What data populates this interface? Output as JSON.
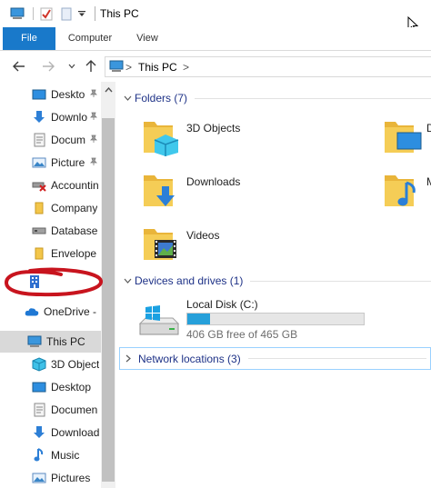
{
  "window": {
    "title": "This PC"
  },
  "ribbon": {
    "tabs": [
      {
        "label": "File"
      },
      {
        "label": "Computer"
      },
      {
        "label": "View"
      }
    ]
  },
  "address": {
    "crumbs": [
      "This PC"
    ],
    "separator": ">"
  },
  "sidebar": {
    "items": [
      {
        "label": "Deskto",
        "icon": "desktop-icon",
        "pinned": true
      },
      {
        "label": "Downlo",
        "icon": "download-arrow-icon",
        "pinned": true
      },
      {
        "label": "Docum",
        "icon": "document-icon",
        "pinned": true
      },
      {
        "label": "Picture",
        "icon": "pictures-icon",
        "pinned": true
      },
      {
        "label": "Accountin",
        "icon": "network-drive-disconnected-icon"
      },
      {
        "label": "Company",
        "icon": "folder-icon"
      },
      {
        "label": "Database",
        "icon": "network-drive-icon"
      },
      {
        "label": "Envelope",
        "icon": "folder-icon"
      },
      {
        "label": "",
        "icon": "building-icon"
      },
      {
        "label": "OneDrive -",
        "icon": "onedrive-cloud-icon"
      },
      {
        "label": "This PC",
        "icon": "this-pc-icon",
        "selected": true
      },
      {
        "label": "3D Object",
        "icon": "3d-objects-icon"
      },
      {
        "label": "Desktop",
        "icon": "desktop-icon"
      },
      {
        "label": "Documen",
        "icon": "document-icon"
      },
      {
        "label": "Download",
        "icon": "download-arrow-icon"
      },
      {
        "label": "Music",
        "icon": "music-note-icon"
      },
      {
        "label": "Pictures",
        "icon": "pictures-icon"
      }
    ]
  },
  "main": {
    "folders_group": {
      "label": "Folders (7)"
    },
    "folders": [
      {
        "label": "3D Objects",
        "icon": "3d-objects-folder-icon"
      },
      {
        "label": "D",
        "icon": "desktop-folder-icon"
      },
      {
        "label": "Downloads",
        "icon": "downloads-folder-icon"
      },
      {
        "label": "M",
        "icon": "music-folder-icon"
      },
      {
        "label": "Videos",
        "icon": "videos-folder-icon"
      }
    ],
    "devices_group": {
      "label": "Devices and drives (1)"
    },
    "drive": {
      "label": "Local Disk (C:)",
      "free_text": "406 GB free of 465 GB",
      "used_fraction": 0.127
    },
    "network_group": {
      "label": "Network locations (3)"
    }
  },
  "colors": {
    "accent": "#1979ca",
    "group_header": "#1e3287",
    "drive_fill": "#26a0da",
    "folder_yellow": "#f3c64a",
    "annotation_red": "#c8141e"
  }
}
